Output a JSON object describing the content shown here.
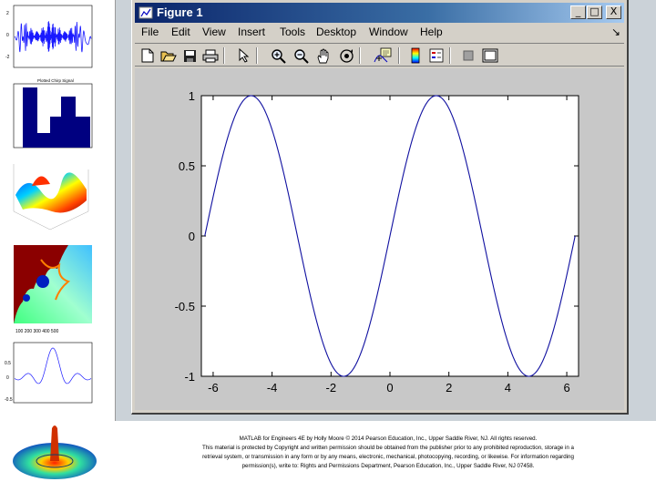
{
  "window": {
    "title": "Figure 1",
    "minimize_label": "_",
    "maximize_label": "□",
    "close_label": "X"
  },
  "menu": {
    "items": [
      {
        "label": "File"
      },
      {
        "label": "Edit"
      },
      {
        "label": "View"
      },
      {
        "label": "Insert"
      },
      {
        "label": "Tools"
      },
      {
        "label": "Desktop"
      },
      {
        "label": "Window"
      },
      {
        "label": "Help"
      }
    ],
    "dock_glyph": "↘"
  },
  "toolbar": {
    "tools": [
      "new-figure-icon",
      "open-file-icon",
      "save-icon",
      "print-icon",
      "edit-plot-arrow-icon",
      "zoom-in-icon",
      "zoom-out-icon",
      "pan-hand-icon",
      "rotate-3d-icon",
      "data-cursor-icon",
      "insert-colorbar-icon",
      "insert-legend-icon",
      "hide-plot-tools-icon",
      "show-plot-tools-icon"
    ]
  },
  "chart_data": {
    "type": "line",
    "function": "sin(x)",
    "x_range": [
      -6.2832,
      6.2832
    ],
    "xlim": [
      -6.4,
      6.4
    ],
    "ylim": [
      -1,
      1
    ],
    "xticks": [
      -6,
      -4,
      -2,
      0,
      2,
      4,
      6
    ],
    "xtick_labels": [
      "-6",
      "-4",
      "-2",
      "0",
      "2",
      "4",
      "6"
    ],
    "yticks": [
      1,
      0.5,
      0,
      -0.5,
      -1
    ],
    "ytick_labels": [
      "1",
      "0.5",
      "0",
      "-0.5",
      "-1"
    ],
    "series": [
      {
        "color": "#1010a0",
        "function": "sin(x)"
      }
    ],
    "grid": false,
    "title": "",
    "xlabel": "",
    "ylabel": ""
  },
  "thumbnails": [
    {
      "kind": "signal-plot",
      "caption": "Plotted Chirp Signal"
    },
    {
      "kind": "bar-histogram"
    },
    {
      "kind": "3d-surface"
    },
    {
      "kind": "fractal-image"
    },
    {
      "kind": "sinc-plot"
    },
    {
      "kind": "3d-sombrero"
    }
  ],
  "caption": {
    "line1": "MATLAB for Engineers 4E by Holly Moore © 2014 Pearson Education, Inc., Upper Saddle River, NJ. All rights reserved.",
    "line2": "This material is protected by Copyright and written permission should be obtained from the publisher prior to any prohibited reproduction, storage in a",
    "line3": "retrieval system, or transmission in any form or by any means, electronic, mechanical, photocopying, recording, or likewise. For information regarding",
    "line4": "permission(s), write to: Rights and Permissions Department, Pearson Education, Inc., Upper Saddle River, NJ 07458."
  },
  "colors": {
    "title_bar": "#0a246a",
    "window_face": "#d4d0c8",
    "figure_bg": "#c8c8c8",
    "axes_bg": "#ffffff",
    "line": "#1010a0"
  }
}
